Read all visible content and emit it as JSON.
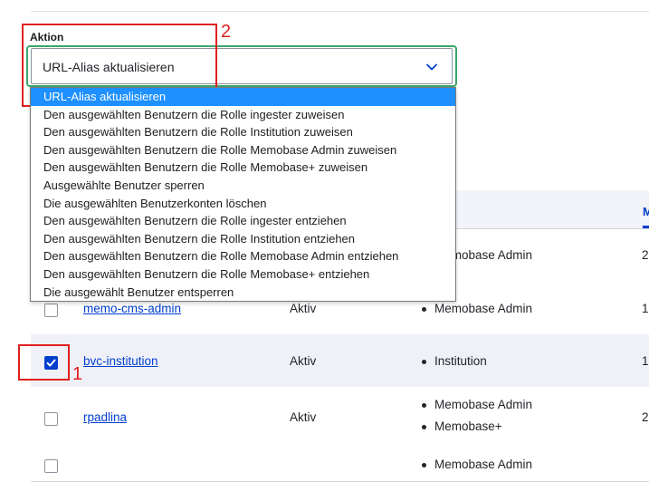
{
  "form": {
    "action_label": "Aktion",
    "selected_value": "URL-Alias aktualisieren"
  },
  "dropdown": {
    "options": [
      "URL-Alias aktualisieren",
      "Den ausgewählten Benutzern die Rolle ingester zuweisen",
      "Den ausgewählten Benutzern die Rolle Institution zuweisen",
      "Den ausgewählten Benutzern die Rolle Memobase Admin zuweisen",
      "Den ausgewählten Benutzern die Rolle Memobase+ zuweisen",
      "Ausgewählte Benutzer sperren",
      "Die ausgewählten Benutzerkonten löschen",
      "Den ausgewählten Benutzern die Rolle ingester entziehen",
      "Den ausgewählten Benutzern die Rolle Institution entziehen",
      "Den ausgewählten Benutzern die Rolle Memobase Admin entziehen",
      "Den ausgewählten Benutzern die Rolle Memobase+ entziehen",
      "Die ausgewählt Benutzer entsperren"
    ],
    "selected_index": 0
  },
  "annotations": {
    "label_1": "1",
    "label_2": "2",
    "highlight_color": "#e02020",
    "frame_color": "#3aa66a"
  },
  "table": {
    "header_partial": "M",
    "rows": [
      {
        "checked": false,
        "username": "",
        "status": "",
        "roles": [
          "Memobase Admin"
        ],
        "last": "2"
      },
      {
        "checked": false,
        "username": "memo-cms-admin",
        "status": "Aktiv",
        "roles": [
          "Memobase Admin"
        ],
        "last": "1"
      },
      {
        "checked": true,
        "username": "bvc-institution",
        "status": "Aktiv",
        "roles": [
          "Institution"
        ],
        "last": "1"
      },
      {
        "checked": false,
        "username": "rpadlina",
        "status": "Aktiv",
        "roles": [
          "Memobase Admin",
          "Memobase+"
        ],
        "last": "2"
      },
      {
        "checked": false,
        "username": "",
        "status": "",
        "roles": [
          "Memobase Admin"
        ],
        "last": ""
      }
    ]
  },
  "colors": {
    "accent": "#003ecc",
    "option_highlight": "#1e90ff"
  }
}
